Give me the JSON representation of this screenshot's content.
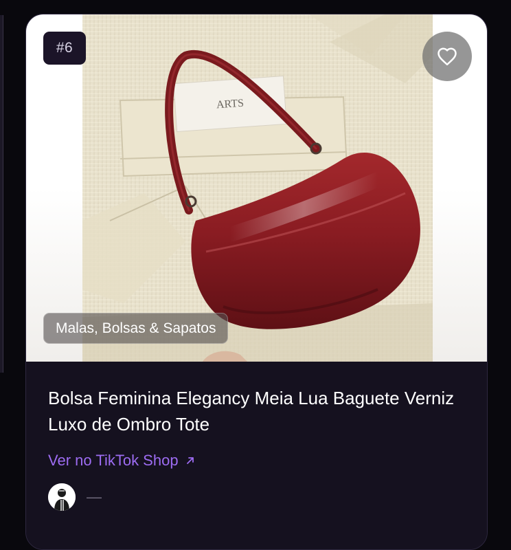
{
  "card": {
    "rank": "#6",
    "category": "Malas, Bolsas & Sapatos",
    "title": "Bolsa Feminina Elegancy Meia Lua Baguete Verniz Luxo de Ombro Tote",
    "shop_link_label": "Ver no TikTok Shop",
    "creator_name": "—",
    "favorite_icon": "heart-icon",
    "link_icon": "arrow-up-right-icon"
  },
  "colors": {
    "background": "#09080d",
    "card": "#15111f",
    "accent": "#9d6cf2",
    "bag": "#8e1f25"
  }
}
